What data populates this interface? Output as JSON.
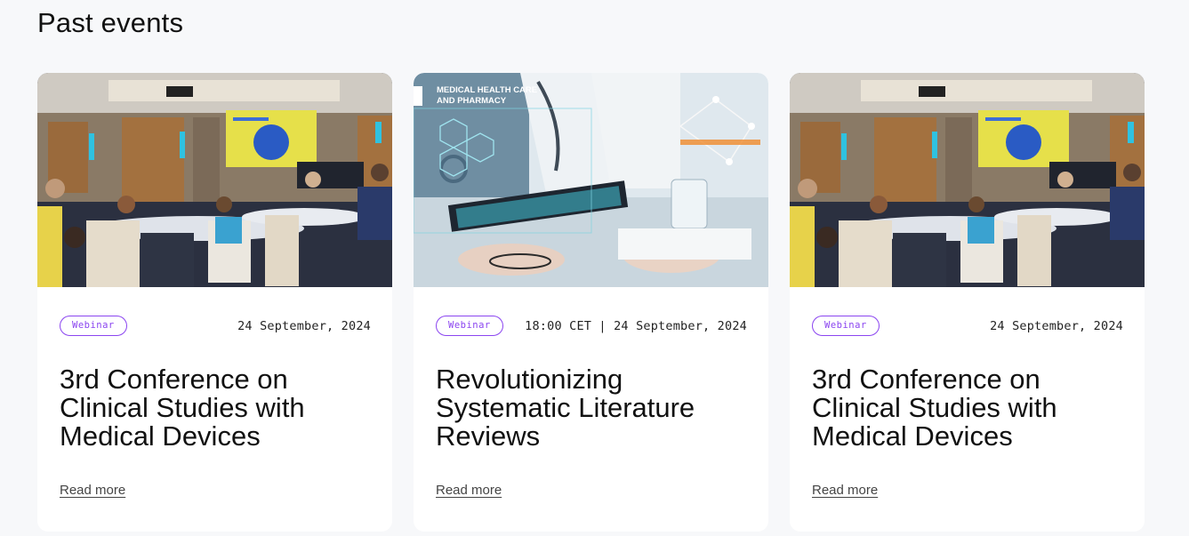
{
  "section": {
    "title": "Past events"
  },
  "cards": [
    {
      "badge": "Webinar",
      "date": "24 September, 2024",
      "title": "3rd Conference on Clinical Studies with Medical Devices",
      "read_more": "Read more"
    },
    {
      "badge": "Webinar",
      "date": "18:00 CET | 24 September, 2024",
      "title": "Revolutionizing Systematic Literature Reviews",
      "read_more": "Read more",
      "image_text": "MEDICAL HEALTH CARE AND PHARMACY"
    },
    {
      "badge": "Webinar",
      "date": "24 September, 2024",
      "title": "3rd Conference on Clinical Studies with Medical Devices",
      "read_more": "Read more"
    }
  ],
  "colors": {
    "accent": "#8b45f0",
    "background": "#f7f8fa",
    "card": "#ffffff"
  }
}
